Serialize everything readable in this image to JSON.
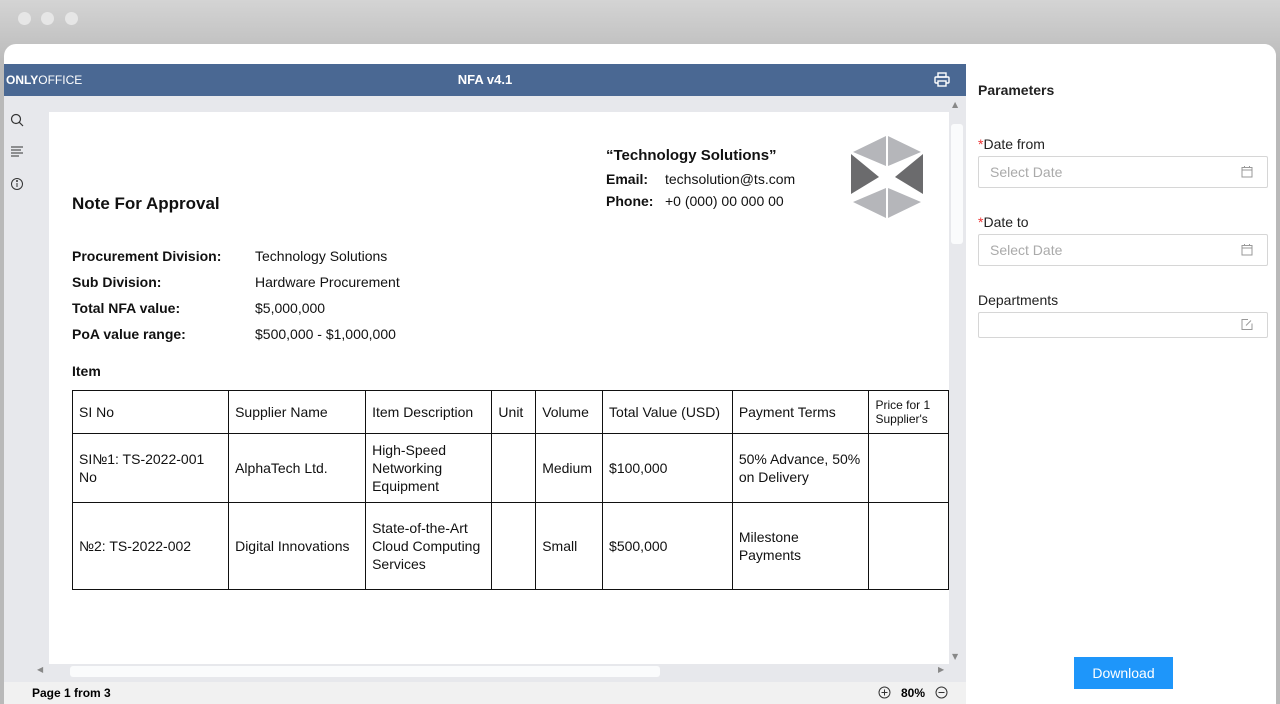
{
  "viewer": {
    "logo_bold": "ONLY",
    "logo_light": "OFFICE",
    "title": "NFA v4.1"
  },
  "doc": {
    "company": "“Technology Solutions”",
    "email_label": "Email:",
    "email": "techsolution@ts.com",
    "phone_label": "Phone:",
    "phone": "+0 (000) 00 000 00",
    "heading": "Note For Approval",
    "fields": [
      {
        "label": "Procurement Division:",
        "value": "Technology Solutions"
      },
      {
        "label": "Sub Division:",
        "value": "Hardware Procurement"
      },
      {
        "label": "Total NFA value:",
        "value": "$5,000,000"
      },
      {
        "label": "PoA value range:",
        "value": "$500,000 - $1,000,000"
      }
    ],
    "item_label": "Item",
    "columns": [
      "SI No",
      "Supplier Name",
      "Item Description",
      "Unit",
      "Volume",
      "Total Value (USD)",
      "Payment Terms",
      "Price for 1 Supplier's"
    ],
    "rows": [
      [
        "SI№1: TS-2022-001 No",
        "AlphaTech Ltd.",
        "High-Speed Networking Equipment",
        "",
        "Medium",
        "$100,000",
        "50% Advance, 50% on Delivery",
        ""
      ],
      [
        "№2: TS-2022-002",
        "Digital Innovations",
        "State-of-the-Art Cloud Computing Services",
        "",
        "Small",
        "$500,000",
        "Milestone Payments",
        ""
      ]
    ]
  },
  "status": {
    "page": "Page 1 from 3",
    "zoom": "80%"
  },
  "params": {
    "title": "Parameters",
    "date_from": {
      "label": "Date from",
      "placeholder": "Select Date"
    },
    "date_to": {
      "label": "Date to",
      "placeholder": "Select Date"
    },
    "departments": {
      "label": "Departments",
      "value": ""
    },
    "required_mark": "*",
    "download": "Download"
  }
}
